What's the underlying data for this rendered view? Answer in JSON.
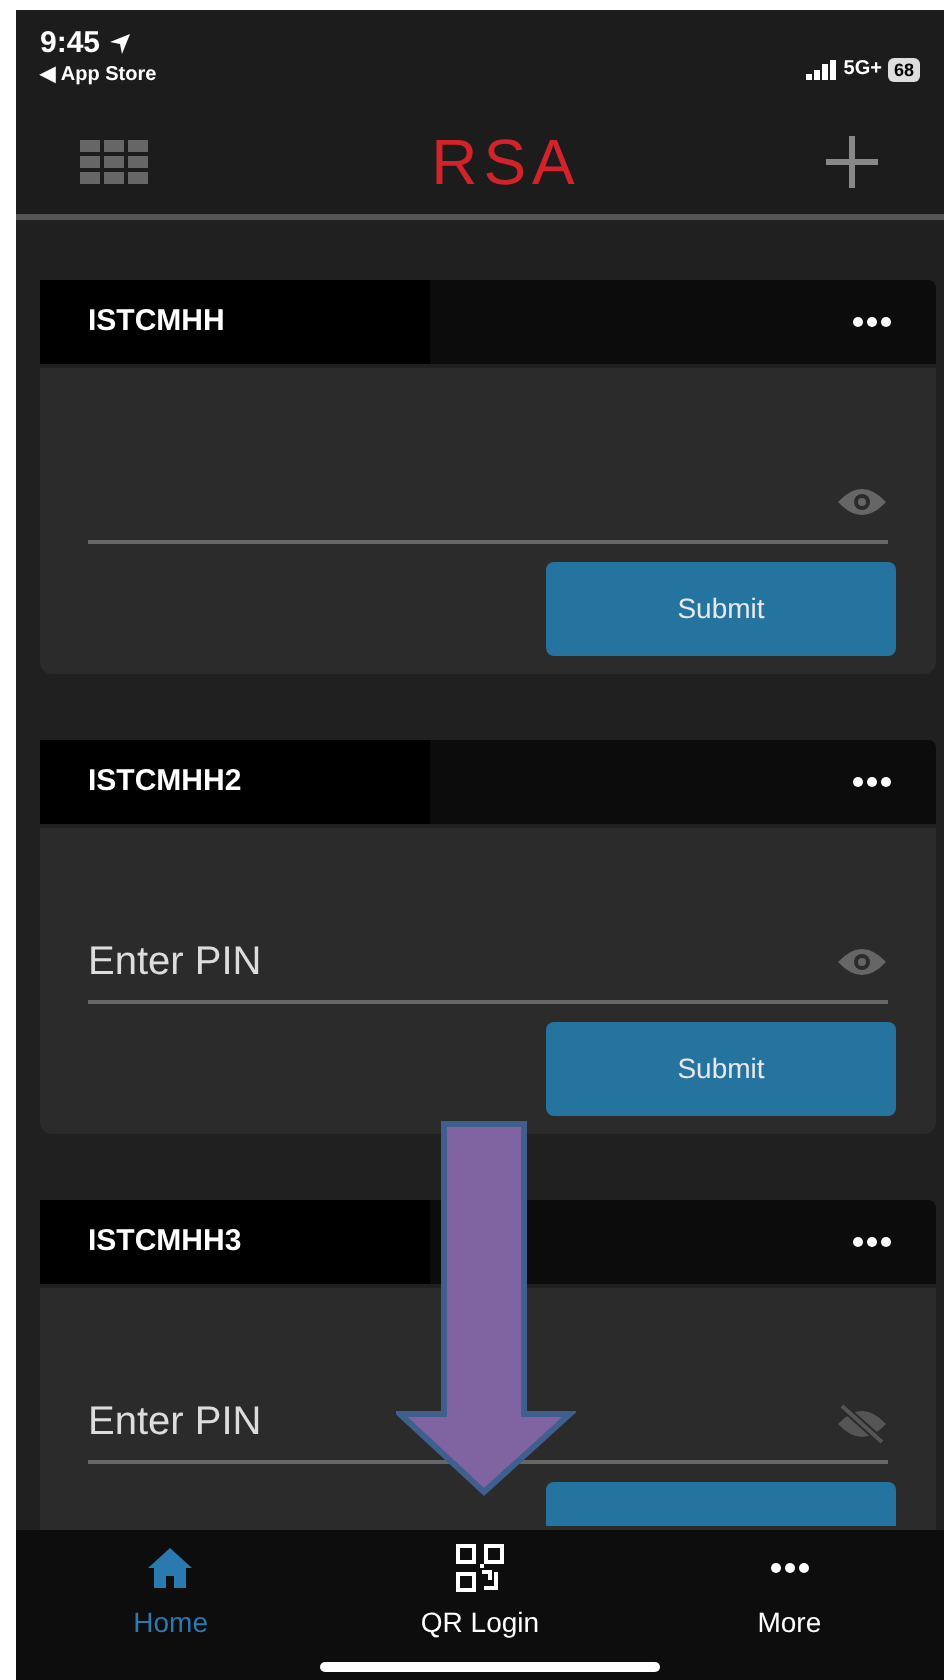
{
  "status_bar": {
    "time": "9:45",
    "back_label": "◀ App Store",
    "network": "5G+",
    "battery": "68"
  },
  "header": {
    "logo": "RSA"
  },
  "cards": [
    {
      "name": "ISTCMHH",
      "masked": false,
      "submit_label": "Submit"
    },
    {
      "name": "ISTCMHH2",
      "placeholder": "Enter PIN",
      "masked": false,
      "submit_label": "Submit"
    },
    {
      "name": "ISTCMHH3",
      "placeholder": "Enter PIN",
      "masked": true
    }
  ],
  "tabs": [
    {
      "kind": "home",
      "label": "Home",
      "selected": true
    },
    {
      "kind": "qr",
      "label": "QR Login",
      "selected": false
    },
    {
      "kind": "more",
      "label": "More",
      "selected": false
    }
  ]
}
